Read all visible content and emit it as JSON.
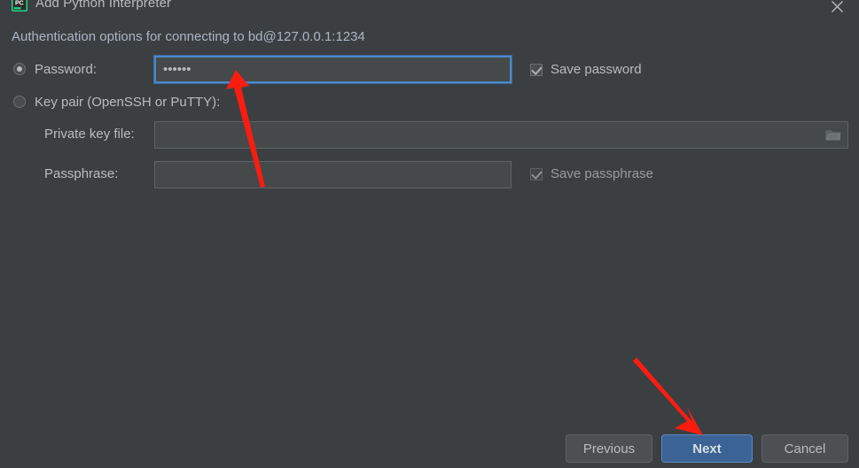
{
  "window": {
    "title": "Add Python Interpreter",
    "app_icon": "pycharm-icon",
    "close_icon": "close-icon"
  },
  "subtitle": "Authentication options for connecting to bd@127.0.0.1:1234",
  "auth": {
    "mode": "password",
    "password_option": {
      "label": "Password:",
      "selected": true,
      "value": "••••••",
      "placeholder": "",
      "focused": true
    },
    "save_password": {
      "label": "Save password",
      "checked": true,
      "enabled": true
    },
    "keypair_option": {
      "label": "Key pair (OpenSSH or PuTTY):",
      "selected": false
    },
    "private_key_file": {
      "label": "Private key file:",
      "value": "",
      "placeholder": "",
      "browse_icon": "folder-icon"
    },
    "passphrase": {
      "label": "Passphrase:",
      "value": "",
      "placeholder": ""
    },
    "save_passphrase": {
      "label": "Save passphrase",
      "checked": true,
      "enabled": false
    }
  },
  "footer": {
    "previous_label": "Previous",
    "next_label": "Next",
    "cancel_label": "Cancel",
    "default_button": "Next"
  },
  "annotations": {
    "arrow_color": "#fb1c10",
    "arrow_password_field": "points up-left to the password input",
    "arrow_next_button": "points down-right to the Next button"
  },
  "colors": {
    "background": "#3c3f41",
    "text": "#bbbbbb",
    "field_background": "#45494a",
    "focus_border": "#4a88c7",
    "primary_button": "#3c6395",
    "annotation_red": "#fb1c10"
  }
}
